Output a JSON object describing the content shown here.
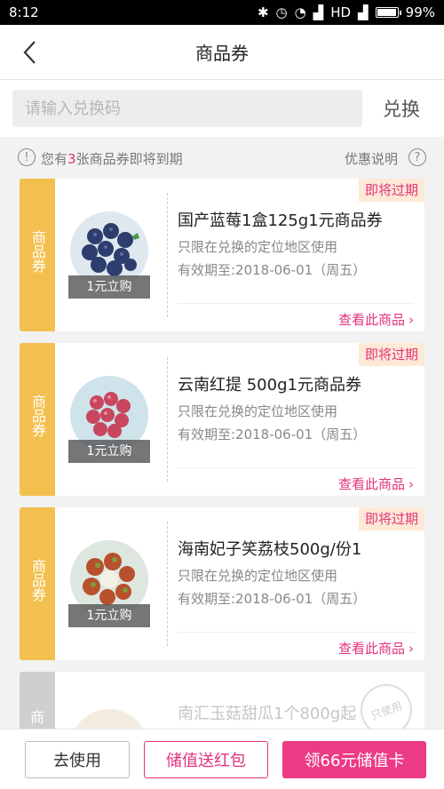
{
  "status_bar": {
    "time": "8:12",
    "network": "HD",
    "battery": "99%",
    "battery_level": 0.99
  },
  "nav": {
    "title": "商品券"
  },
  "redeem": {
    "placeholder": "请输入兑换码",
    "button": "兑换"
  },
  "notice": {
    "prefix": "您有",
    "count": "3",
    "suffix": "张商品券即将到期",
    "explain": "优惠说明"
  },
  "coupons": [
    {
      "type_label": "商品券",
      "buy_label": "1元立购",
      "name": "国产蓝莓1盒125g1元商品券",
      "scope": "只限在兑换的定位地区使用",
      "expiry": "有效期至:2018-06-01（周五）",
      "tag": "即将过期",
      "view": "查看此商品"
    },
    {
      "type_label": "商品券",
      "buy_label": "1元立购",
      "name": "云南红提 500g1元商品券",
      "scope": "只限在兑换的定位地区使用",
      "expiry": "有效期至:2018-06-01（周五）",
      "tag": "即将过期",
      "view": "查看此商品"
    },
    {
      "type_label": "商品券",
      "buy_label": "1元立购",
      "name": "海南妃子笑荔枝500g/份1",
      "scope": "只限在兑换的定位地区使用",
      "expiry": "有效期至:2018-06-01（周五）",
      "tag": "即将过期",
      "view": "查看此商品"
    },
    {
      "type_label": "商",
      "name": "南汇玉菇甜瓜1个800g起",
      "stamp": "只使用"
    }
  ],
  "footer": {
    "use": "去使用",
    "topup": "储值送红包",
    "claim": "领66元储值卡"
  },
  "colors": {
    "accent": "#e2327c",
    "coupon_side": "#f3c04f",
    "coupon_side_used": "#cfcfcf",
    "claim_bg": "#ec3a87"
  }
}
